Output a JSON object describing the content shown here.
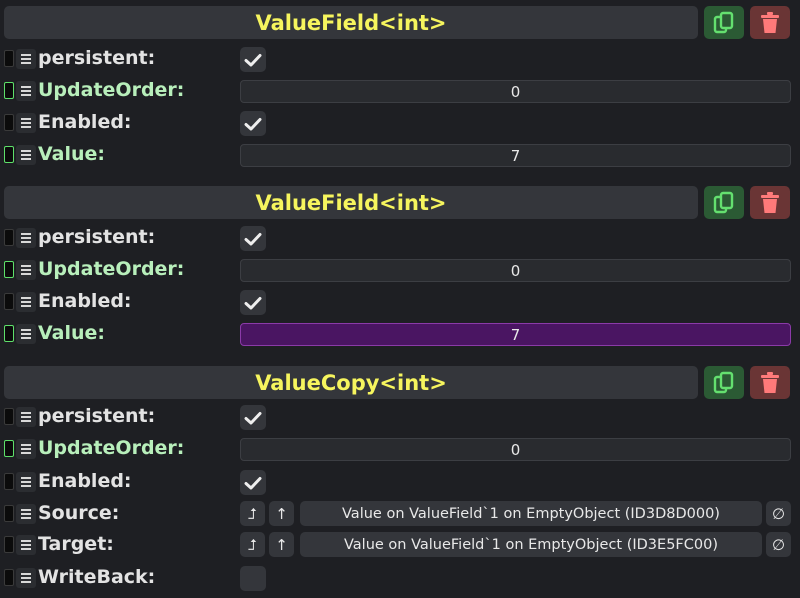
{
  "components": [
    {
      "title": "ValueField<int>",
      "fields": [
        {
          "label": "persistent:",
          "type": "checkbox",
          "checked": true
        },
        {
          "label": "UpdateOrder:",
          "type": "number",
          "value": "0"
        },
        {
          "label": "Enabled:",
          "type": "checkbox",
          "checked": true
        },
        {
          "label": "Value:",
          "type": "number",
          "value": "7"
        }
      ]
    },
    {
      "title": "ValueField<int>",
      "fields": [
        {
          "label": "persistent:",
          "type": "checkbox",
          "checked": true
        },
        {
          "label": "UpdateOrder:",
          "type": "number",
          "value": "0"
        },
        {
          "label": "Enabled:",
          "type": "checkbox",
          "checked": true
        },
        {
          "label": "Value:",
          "type": "number",
          "value": "7",
          "highlighted": true
        }
      ]
    },
    {
      "title": "ValueCopy<int>",
      "fields": [
        {
          "label": "persistent:",
          "type": "checkbox",
          "checked": true
        },
        {
          "label": "UpdateOrder:",
          "type": "number",
          "value": "0"
        },
        {
          "label": "Enabled:",
          "type": "checkbox",
          "checked": true
        },
        {
          "label": "Source:",
          "type": "reference",
          "value": "Value on ValueField`1 on EmptyObject (ID3D8D000)"
        },
        {
          "label": "Target:",
          "type": "reference",
          "value": "Value on ValueField`1 on EmptyObject (ID3E5FC00)"
        },
        {
          "label": "WriteBack:",
          "type": "checkbox",
          "checked": false
        }
      ]
    }
  ],
  "icons": {
    "duplicate": "duplicate-icon",
    "delete": "trash-icon",
    "checkmark": "checkmark-icon",
    "drag_handle": "drag-handle-icon",
    "jump_to": "jump-to-icon",
    "open_inspector": "up-arrow-icon",
    "clear_reference": "null-icon"
  },
  "glyphs": {
    "jump": "⮥",
    "up": "↑",
    "null": "∅"
  },
  "colors": {
    "background": "#1e1f23",
    "header": "#34363b",
    "title": "#f6f55e",
    "duplicate_button": "#2b5a34",
    "duplicate_icon": "#64e06f",
    "delete_button": "#6a3535",
    "delete_icon": "#ff7a7a",
    "green_label": "#b8efbb",
    "highlight": "#4a1562"
  }
}
